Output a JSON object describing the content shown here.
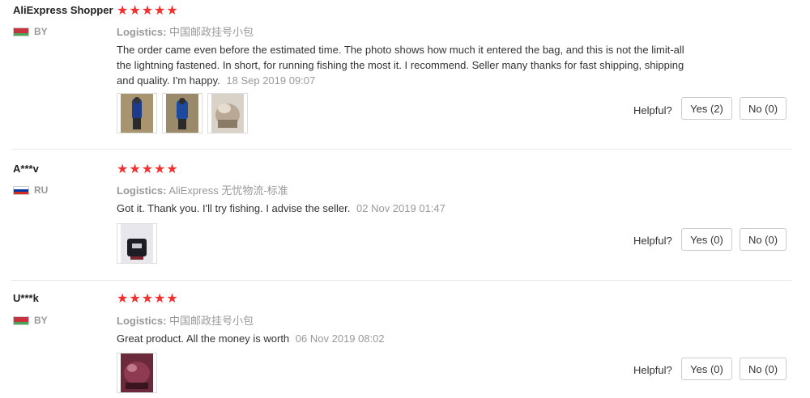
{
  "helpful_label": "Helpful?",
  "logistics_label": "Logistics:",
  "star_glyph": "★",
  "star_color": "#f23030",
  "reviews": [
    {
      "user": "AliExpress Shopper",
      "country": "BY",
      "flag": "by-flag",
      "rating": 5,
      "logistics": "中国邮政挂号小包",
      "text": "The order came even before the estimated time. The photo shows how much it entered the bag, and this is not the limit-all the lightning fastened. In short, for running fishing the most it. I recommend. Seller many thanks for fast shipping, shipping and quality. I'm happy.",
      "date": "18 Sep 2019 09:07",
      "yes": "Yes (2)",
      "no": "No (0)",
      "photos": 3
    },
    {
      "user": "A***v",
      "country": "RU",
      "flag": "ru-flag",
      "rating": 5,
      "logistics": "AliExpress 无忧物流-标准",
      "text": "Got it. Thank you. I'll try fishing. I advise the seller.",
      "date": "02 Nov 2019 01:47",
      "yes": "Yes (0)",
      "no": "No (0)",
      "photos": 1
    },
    {
      "user": "U***k",
      "country": "BY",
      "flag": "by-flag",
      "rating": 5,
      "logistics": "中国邮政挂号小包",
      "text": "Great product. All the money is worth",
      "date": "06 Nov 2019 08:02",
      "yes": "Yes (0)",
      "no": "No (0)",
      "photos": 1
    }
  ]
}
